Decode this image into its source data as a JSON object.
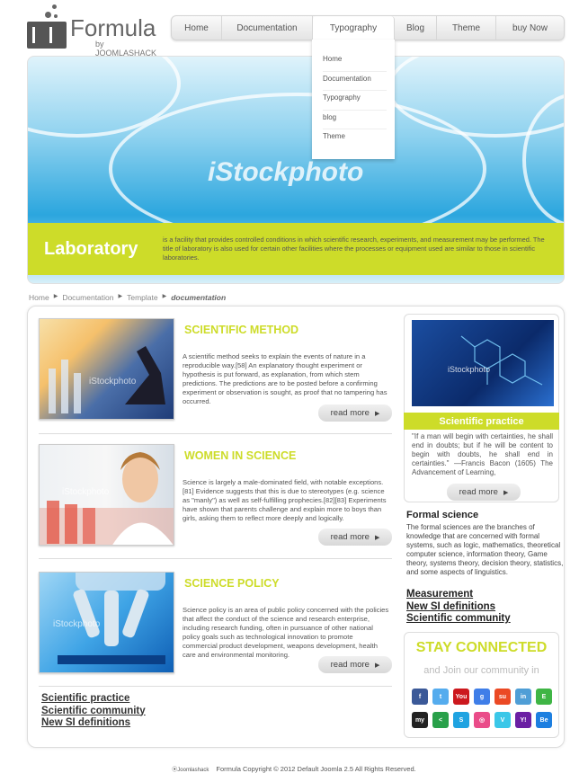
{
  "logo": {
    "name": "Formula",
    "by": "by JOOMLASHACK"
  },
  "nav": [
    {
      "label": "Home"
    },
    {
      "label": "Documentation"
    },
    {
      "label": "Typography"
    },
    {
      "label": "Blog"
    },
    {
      "label": "Theme"
    },
    {
      "label": "buy Now"
    }
  ],
  "dropdown": [
    "Home",
    "Documentation",
    "Typography",
    "blog",
    "Theme"
  ],
  "hero": {
    "watermark": "iStockphoto",
    "title": "Laboratory",
    "description": "is a facility that provides controlled conditions in which scientific research, experiments, and measurement may be performed. The title of laboratory is also used for certain other facilities where the processes or equipment used are similar to those in scientific laboratories."
  },
  "breadcrumb": [
    "Home",
    "Documentation",
    "Template",
    "documentation"
  ],
  "articles": [
    {
      "title": "SCIENTIFIC METHOD",
      "body": "A scientific method seeks to explain the events of nature in a reproducible way.[58] An explanatory thought experiment or hypothesis is put forward, as explanation, from which stem predictions. The predictions are to be posted before a confirming experiment or observation is sought, as proof that no tampering has occurred.",
      "read_more": "read more"
    },
    {
      "title": "WOMEN IN SCIENCE",
      "body": "Science is largely a male-dominated field, with notable exceptions.[81] Evidence suggests that this is due to stereotypes (e.g. science as \"manly\") as well as self-fulfilling prophecies.[82][83] Experiments have shown that parents challenge and explain more to boys than girls, asking them to reflect more deeply and logically.",
      "read_more": "read more"
    },
    {
      "title": "SCIENCE POLICY",
      "body": "Science policy is an area of public policy concerned with the policies that affect the conduct of the science and research enterprise, including research funding, often in pursuance of other national policy goals such as technological innovation to promote commercial product development, weapons development, health care and environmental monitoring.",
      "read_more": "read more"
    }
  ],
  "bottom_links": [
    "Scientific practice",
    "Scientific community",
    "New SI definitions"
  ],
  "sidebar": {
    "card_title": "Scientific practice",
    "quote": "\"If a man will begin with certainties, he shall end in doubts; but if he will be content to begin with doubts, he shall end in certainties.\" —Francis Bacon (1605) The Advancement of Learning,",
    "read_more": "read more",
    "formal_title": "Formal science",
    "formal_body": "The formal sciences are the branches of knowledge that are concerned with formal systems, such as logic, mathematics, theoretical computer science, information theory, Game theory, systems theory, decision theory, statistics, and some aspects of linguistics.",
    "links": [
      "Measurement",
      "New SI definitions",
      "Scientific community"
    ],
    "stay_title": "STAY CONNECTED",
    "stay_sub": "and Join our community in"
  },
  "socials": [
    {
      "icon": "facebook-icon",
      "glyph": "f",
      "color": "#3b5998"
    },
    {
      "icon": "twitter-icon",
      "glyph": "t",
      "color": "#55acee"
    },
    {
      "icon": "youtube-icon",
      "glyph": "You",
      "color": "#cc181e"
    },
    {
      "icon": "google-plus-icon",
      "glyph": "g",
      "color": "#3f7ee8"
    },
    {
      "icon": "stumbleupon-icon",
      "glyph": "su",
      "color": "#eb4924"
    },
    {
      "icon": "linkedin-icon",
      "glyph": "in",
      "color": "#4f9ed6"
    },
    {
      "icon": "evernote-icon",
      "glyph": "E",
      "color": "#3fb545"
    },
    {
      "icon": "myspace-icon",
      "glyph": "my",
      "color": "#222222"
    },
    {
      "icon": "sharethis-icon",
      "glyph": "<",
      "color": "#29a04a"
    },
    {
      "icon": "skype-icon",
      "glyph": "S",
      "color": "#1fa3e1"
    },
    {
      "icon": "dribbble-icon",
      "glyph": "◎",
      "color": "#ea4c89"
    },
    {
      "icon": "vimeo-icon",
      "glyph": "V",
      "color": "#3ac7e8"
    },
    {
      "icon": "yahoo-icon",
      "glyph": "Y!",
      "color": "#6b1fa3"
    },
    {
      "icon": "behance-icon",
      "glyph": "Be",
      "color": "#1d7fe0"
    }
  ],
  "footer": {
    "brand": "Joomlashack",
    "text": "Formula Copyright © 2012 Default Joomla 2.5 All Rights Reserved."
  },
  "colors": {
    "accent": "#cddc29"
  }
}
